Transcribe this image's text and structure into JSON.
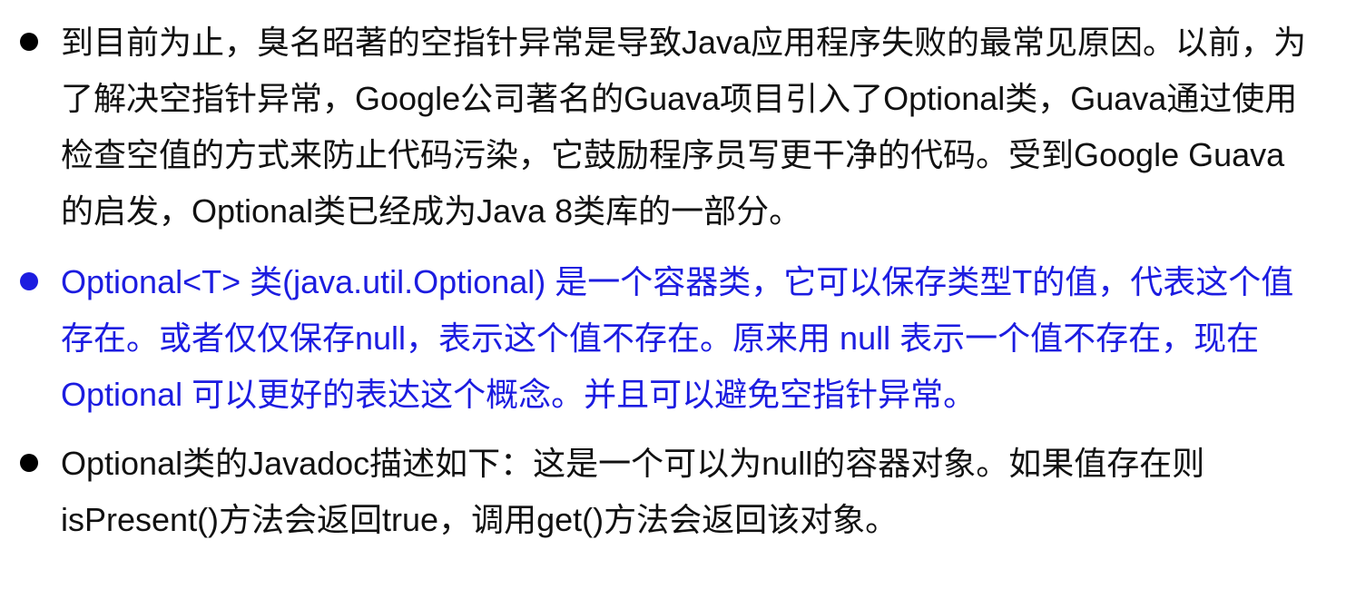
{
  "bullets": [
    {
      "text": "到目前为止，臭名昭著的空指针异常是导致Java应用程序失败的最常见原因。以前，为了解决空指针异常，Google公司著名的Guava项目引入了Optional类，Guava通过使用检查空值的方式来防止代码污染，它鼓励程序员写更干净的代码。受到Google Guava的启发，Optional类已经成为Java 8类库的一部分。",
      "color": "#111111"
    },
    {
      "text": "Optional<T> 类(java.util.Optional) 是一个容器类，它可以保存类型T的值，代表这个值存在。或者仅仅保存null，表示这个值不存在。原来用 null 表示一个值不存在，现在 Optional 可以更好的表达这个概念。并且可以避免空指针异常。",
      "color": "#1c1ce0"
    },
    {
      "text": "Optional类的Javadoc描述如下：这是一个可以为null的容器对象。如果值存在则isPresent()方法会返回true，调用get()方法会返回该对象。",
      "color": "#111111"
    }
  ]
}
